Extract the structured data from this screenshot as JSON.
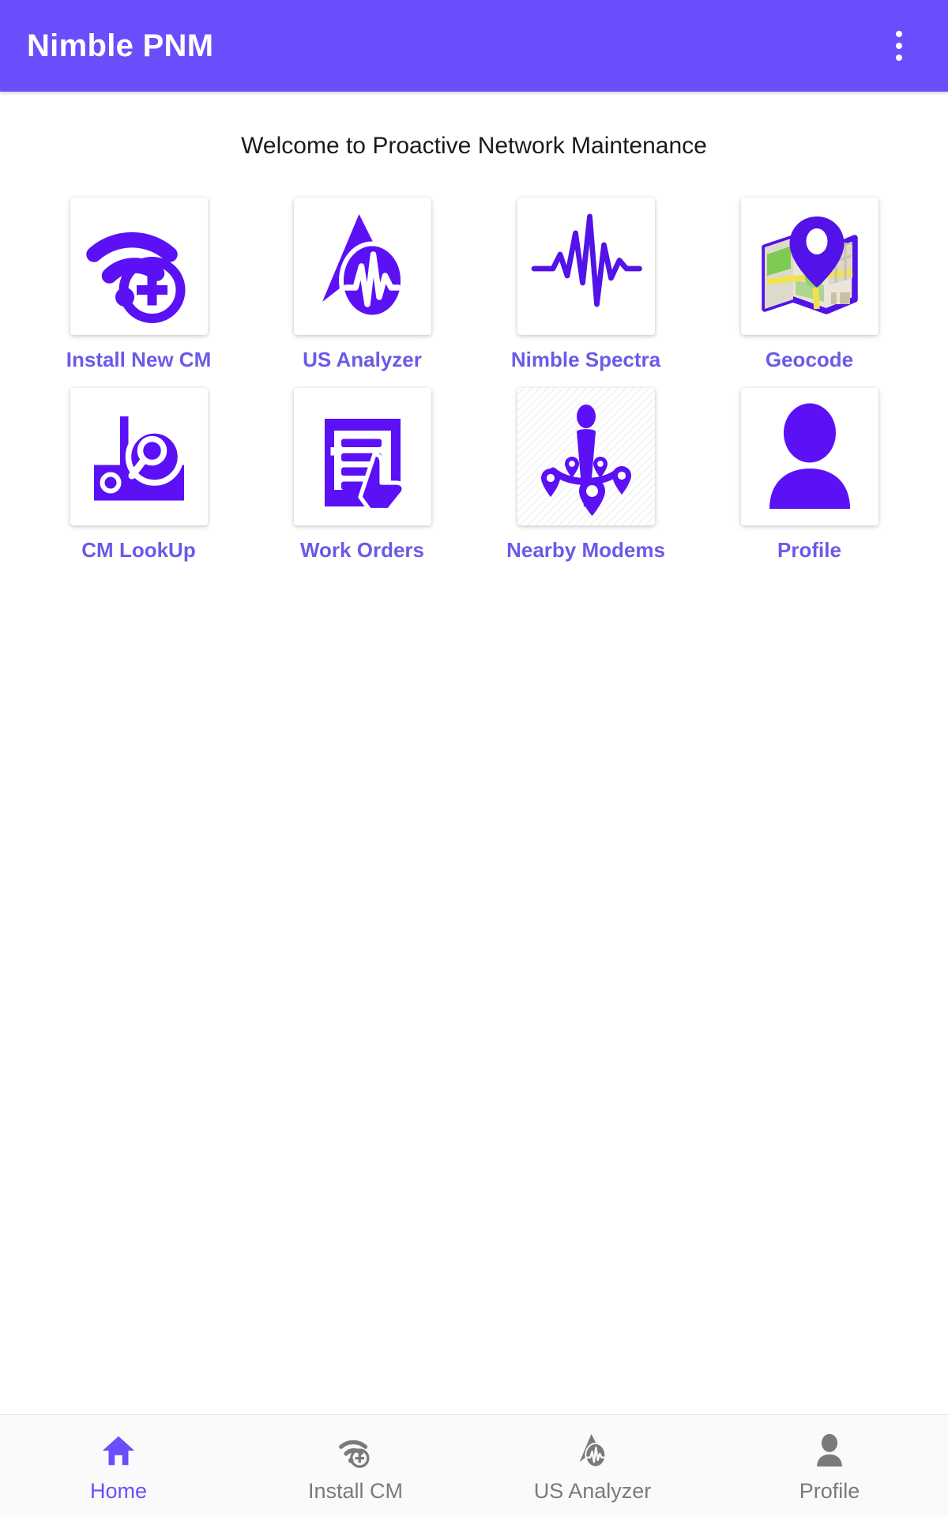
{
  "appbar": {
    "title": "Nimble PNM",
    "overflow_icon": "more-vert-icon"
  },
  "main": {
    "welcome_text": "Welcome to Proactive Network Maintenance",
    "tiles": [
      {
        "label": "Install New CM",
        "icon": "wifi-plus-icon"
      },
      {
        "label": "US Analyzer",
        "icon": "navigation-waveform-icon"
      },
      {
        "label": "Nimble Spectra",
        "icon": "pulse-waveform-icon"
      },
      {
        "label": "Geocode",
        "icon": "map-pin-icon"
      },
      {
        "label": "CM LookUp",
        "icon": "modem-search-icon"
      },
      {
        "label": "Work Orders",
        "icon": "document-hand-icon"
      },
      {
        "label": "Nearby Modems",
        "icon": "person-location-pins-icon"
      },
      {
        "label": "Profile",
        "icon": "person-avatar-icon"
      }
    ]
  },
  "bottom_nav": {
    "items": [
      {
        "label": "Home",
        "icon": "home-icon",
        "active": true
      },
      {
        "label": "Install CM",
        "icon": "wifi-plus-icon",
        "active": false
      },
      {
        "label": "US Analyzer",
        "icon": "navigation-waveform-icon",
        "active": false
      },
      {
        "label": "Profile",
        "icon": "person-avatar-icon",
        "active": false
      }
    ]
  },
  "colors": {
    "brand_purple": "#6B4DFB",
    "icon_purple": "#5B10F5",
    "label_purple": "#6B5AE8",
    "nav_inactive": "#7A7A7A",
    "background": "#FFFFFF",
    "nav_background": "#FAFAFA"
  }
}
